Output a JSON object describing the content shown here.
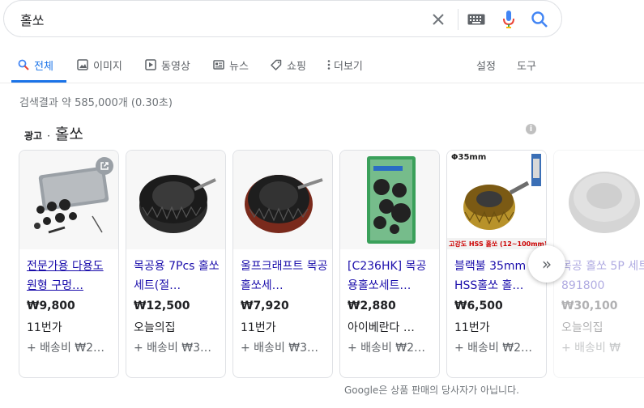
{
  "search": {
    "query": "홀쏘"
  },
  "tabs": [
    {
      "label": "전체",
      "icon": "search-icon",
      "active": true
    },
    {
      "label": "이미지",
      "icon": "image-icon"
    },
    {
      "label": "동영상",
      "icon": "video-icon"
    },
    {
      "label": "뉴스",
      "icon": "news-icon"
    },
    {
      "label": "쇼핑",
      "icon": "tag-icon"
    },
    {
      "label": "더보기",
      "icon": "more-vert-icon"
    }
  ],
  "tools": {
    "settings": "설정",
    "tools": "도구"
  },
  "stats": "검색결과 약 585,000개 (0.30초)",
  "ads": {
    "label": "광고",
    "dot": "·",
    "title": "홀쏘",
    "info": "i"
  },
  "products": [
    {
      "name": "전문가용 다용도 원형 구멍…",
      "price": "₩9,800",
      "seller": "11번가",
      "shipping": "+ 배송비 ₩2…"
    },
    {
      "name": "목공용 7Pcs 홀쏘세트(절…",
      "price": "₩12,500",
      "seller": "오늘의집",
      "shipping": "+ 배송비 ₩3…"
    },
    {
      "name": "울프크래프트 목공홀쏘세…",
      "price": "₩7,920",
      "seller": "11번가",
      "shipping": "+ 배송비 ₩3…"
    },
    {
      "name": "[C236HK] 목공용홀쏘세트…",
      "price": "₩2,880",
      "seller": "아이베란다 …",
      "shipping": "+ 배송비 ₩2…"
    },
    {
      "name": "블랙불 35mm HSS홀쏘 홀…",
      "price": "₩6,500",
      "seller": "11번가",
      "shipping": "+ 배송비 ₩2…",
      "img_text_top": "Φ35mm",
      "img_text_bottom": "고강도 HSS 홀쏘 (12~100mm)"
    },
    {
      "name": "목공 홀쏘 5P 세트 891800",
      "price": "₩30,100",
      "seller": "오늘의집",
      "shipping": "+ 배송비 ₩"
    }
  ],
  "next_button": "»",
  "disclaimer": "Google은 상품 판매의 당사자가 아닙니다.",
  "colors": {
    "accent": "#1a73e8",
    "link": "#1a0dab",
    "muted": "#70757a"
  }
}
